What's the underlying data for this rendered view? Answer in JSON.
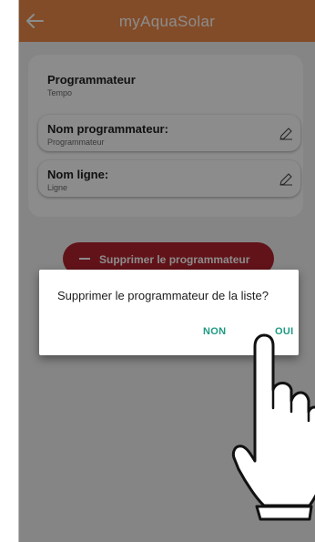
{
  "app_bar": {
    "title": "myAquaSolar",
    "back_icon": "arrow-left-icon",
    "color": "#ef8a4a"
  },
  "card": {
    "section_title": "Programmateur",
    "section_value": "Tempo",
    "fields": [
      {
        "label": "Nom programmateur:",
        "value": "Programmateur",
        "icon": "pencil-icon"
      },
      {
        "label": "Nom ligne:",
        "value": "Ligne",
        "icon": "pencil-icon"
      }
    ]
  },
  "delete_button": {
    "label": "Supprimer le programmateur",
    "icon": "minus-icon",
    "color": "#b3232f"
  },
  "dialog": {
    "message": "Supprimer le programmateur de la liste?",
    "no_label": "NON",
    "yes_label": "OUI",
    "button_color": "#1e9a82"
  },
  "pointer": {
    "icon": "pointing-hand-icon"
  }
}
